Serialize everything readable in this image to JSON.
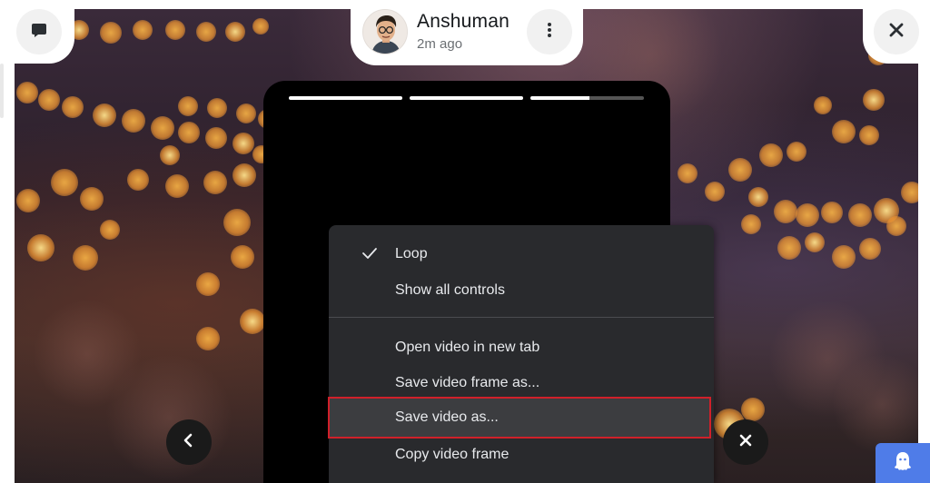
{
  "header": {
    "user_name": "Anshuman",
    "timestamp": "2m ago"
  },
  "icons": {
    "chat": "chat-bubble-icon",
    "more": "more-vertical-icon",
    "close": "close-icon",
    "prev": "chevron-left-icon",
    "close_video": "close-icon",
    "ghost": "ghost-icon",
    "check": "checkmark-icon"
  },
  "story_progress": [
    1,
    1,
    0.5
  ],
  "context_menu": {
    "items": [
      {
        "label": "Loop",
        "checked": true
      },
      {
        "label": "Show all controls",
        "checked": false
      },
      {
        "label": "Open video in new tab",
        "checked": false
      },
      {
        "label": "Save video frame as...",
        "checked": false
      },
      {
        "label": "Save video as...",
        "checked": false,
        "highlighted": true
      },
      {
        "label": "Copy video frame",
        "checked": false
      }
    ]
  },
  "colors": {
    "highlight_border": "#d0202a",
    "menu_bg": "#292a2d",
    "ghost_button": "#4f7ce8"
  }
}
